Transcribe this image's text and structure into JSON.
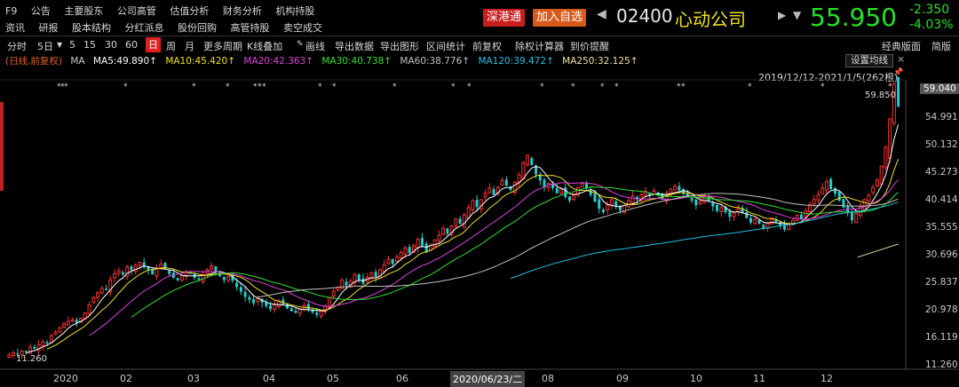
{
  "menu_row1": [
    "F9",
    "公告",
    "主要股东",
    "公司高管",
    "估值分析",
    "财务分析",
    "机构持股"
  ],
  "menu_row2": [
    "资讯",
    "研报",
    "股本结构",
    "分红派息",
    "股份回购",
    "高管持股",
    "卖空成交"
  ],
  "header": {
    "sh_hk_badge": "深港通",
    "add_watch_label": "加入自选",
    "code": "02400",
    "name": "心动公司",
    "price": "55.950",
    "change": "-2.350",
    "change_pct": "-4.03%",
    "nav_left_icon": "triangle-left-icon",
    "nav_right_icon": "triangle-right-icon",
    "colors": {
      "up": "#ff3030",
      "down": "#25e025",
      "name": "#f0e020",
      "accent": "#e02020"
    }
  },
  "toolbar": {
    "fenshi": "分时",
    "five_day": "5日",
    "p5": "5",
    "p15": "15",
    "p30": "30",
    "p60": "60",
    "day": "日",
    "week": "周",
    "month": "月",
    "more_period": "更多周期",
    "k_overlay": "K线叠加",
    "draw": "画线",
    "export_data": "导出数据",
    "export_chart": "导出图形",
    "range_stats": "区间统计",
    "fq": "前复权",
    "calc": "除权计算器",
    "alert": "到价提醒",
    "classic": "经典版面",
    "minimal": "简版"
  },
  "ma_legend": {
    "mode": "(日线,前复权)",
    "ma": "MA",
    "ma5": "MA5:49.890↑",
    "ma10": "MA10:45.420↑",
    "ma20": "MA20:42.363↑",
    "ma30": "MA30:40.738↑",
    "ma60": "MA60:38.776↑",
    "ma120": "MA120:39.472↑",
    "ma250": "MA250:32.125↑",
    "colors": {
      "ma5": "#ffffff",
      "ma10": "#f0e020",
      "ma20": "#e040e0",
      "ma30": "#30e030",
      "ma60": "#c0c0c0",
      "ma120": "#20c0e0",
      "ma250": "#f0e0a0"
    }
  },
  "set_ma_label": "设置均线",
  "range_label": "2019/12/12-2021/1/5(262根)",
  "max_label": "59.850",
  "min_label": "11.260",
  "crosshair_date": "2020/06/23/二",
  "yaxis": [
    "59.040",
    "54.991",
    "50.132",
    "45.273",
    "40.414",
    "35.555",
    "30.696",
    "25.837",
    "20.978",
    "16.119",
    "11.260"
  ],
  "xaxis": [
    "2020",
    "02",
    "03",
    "04",
    "05",
    "06",
    "07",
    "08",
    "09",
    "10",
    "11",
    "12"
  ],
  "chart_data": {
    "type": "candlestick",
    "x_start": "2019/12/12",
    "x_end": "2021/1/5",
    "bars": 262,
    "ylim": [
      11.26,
      59.04
    ],
    "closes": [
      12.8,
      13.2,
      12.9,
      13.5,
      13.3,
      14.2,
      13.9,
      14.6,
      15.1,
      14.8,
      16.2,
      16.8,
      17.5,
      18.2,
      18.6,
      18.9,
      18.4,
      19.2,
      20.1,
      21.5,
      22.8,
      23.6,
      24.4,
      24.1,
      25.8,
      26.9,
      27.4,
      26.8,
      28.1,
      27.6,
      28.4,
      28.9,
      28.2,
      27.5,
      26.8,
      27.9,
      28.6,
      27.8,
      26.9,
      26.2,
      25.8,
      26.6,
      27.3,
      26.9,
      26.2,
      25.9,
      26.8,
      27.6,
      28.3,
      27.4,
      26.5,
      25.8,
      26.4,
      25.7,
      24.6,
      23.8,
      22.9,
      22.4,
      21.8,
      22.6,
      21.9,
      21.3,
      20.8,
      21.5,
      22.2,
      21.6,
      20.9,
      20.4,
      20.1,
      20.8,
      21.4,
      20.6,
      20.2,
      19.8,
      20.5,
      21.3,
      22.8,
      23.9,
      24.6,
      25.8,
      24.9,
      25.6,
      26.8,
      25.9,
      25.2,
      26.3,
      27.1,
      26.4,
      27.6,
      28.5,
      29.4,
      28.6,
      29.8,
      30.6,
      31.4,
      30.5,
      31.8,
      32.9,
      31.8,
      30.6,
      31.9,
      32.8,
      33.6,
      34.8,
      33.9,
      35.2,
      36.4,
      35.6,
      37.1,
      38.4,
      39.6,
      38.5,
      39.8,
      40.9,
      41.8,
      40.6,
      41.9,
      43.1,
      42.2,
      41.5,
      42.8,
      44.1,
      46.2,
      47.5,
      45.8,
      44.2,
      43.1,
      41.9,
      42.6,
      41.8,
      40.9,
      41.6,
      40.2,
      39.6,
      40.8,
      41.9,
      42.6,
      41.8,
      40.6,
      39.4,
      38.2,
      37.6,
      38.9,
      39.8,
      38.6,
      37.9,
      38.8,
      39.6,
      40.4,
      39.8,
      40.6,
      41.2,
      40.5,
      41.3,
      40.6,
      39.8,
      40.9,
      41.6,
      42.1,
      41.4,
      40.8,
      40.2,
      39.6,
      38.8,
      39.5,
      40.2,
      39.6,
      38.6,
      37.8,
      38.4,
      37.6,
      36.8,
      37.5,
      38.2,
      37.4,
      36.6,
      35.8,
      36.4,
      35.6,
      34.9,
      35.8,
      36.6,
      35.9,
      35.2,
      34.6,
      35.4,
      36.2,
      37.1,
      36.4,
      37.8,
      38.9,
      39.8,
      40.6,
      41.8,
      42.9,
      41.6,
      40.8,
      39.6,
      38.4,
      37.6,
      36.2,
      37.4,
      38.6,
      39.8,
      40.6,
      41.9,
      43.2,
      45.6,
      48.9,
      53.8,
      59.85,
      55.95
    ]
  }
}
